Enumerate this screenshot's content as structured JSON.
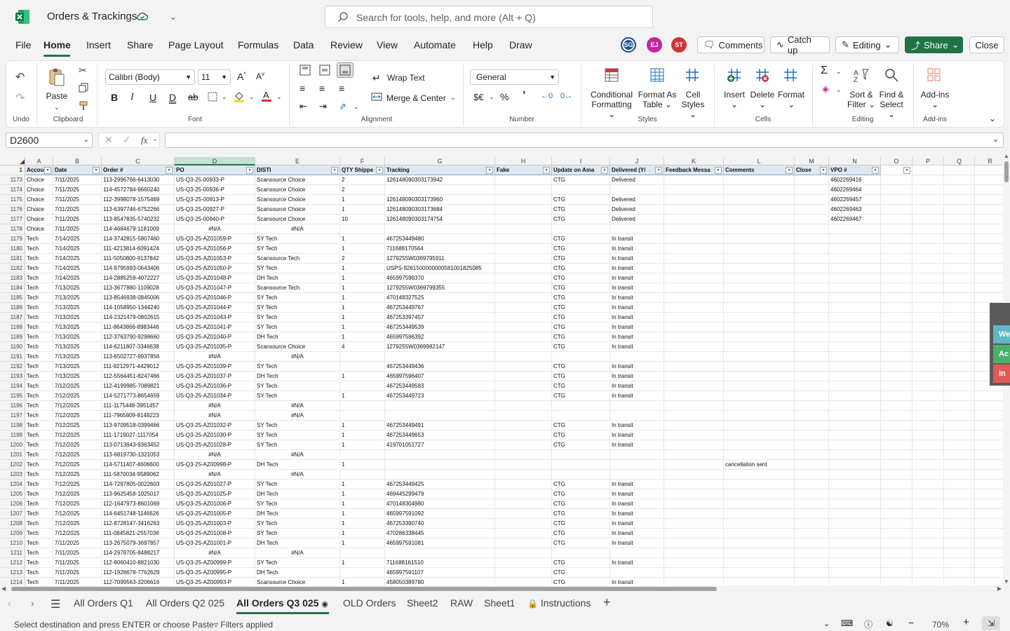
{
  "titlebar": {
    "doc_title": "Orders & Trackings",
    "search_placeholder": "Search for tools, help, and more (Alt + Q)"
  },
  "menu": {
    "tabs": [
      "File",
      "Home",
      "Insert",
      "Share",
      "Page Layout",
      "Formulas",
      "Data",
      "Review",
      "View",
      "Automate",
      "Help",
      "Draw"
    ]
  },
  "collab": {
    "avatars": [
      {
        "initials": "SG",
        "color": "#1f4e8c"
      },
      {
        "initials": "EJ",
        "color": "#c0289d"
      },
      {
        "initials": "ST",
        "color": "#d13438"
      }
    ],
    "comments_label": "Comments",
    "catchup_label": "Catch up",
    "editing_label": "Editing",
    "share_label": "Share",
    "close_label": "Close"
  },
  "ribbon": {
    "undo_label": "Undo",
    "paste_label": "Paste",
    "clipboard_label": "Clipboard",
    "font_name": "Calibri (Body)",
    "font_size": "11",
    "font_label": "Font",
    "wrap_text": "Wrap Text",
    "merge_center": "Merge & Center",
    "alignment_label": "Alignment",
    "number_format": "General",
    "number_label": "Number",
    "conditional_formatting": [
      "Conditional",
      "Formatting"
    ],
    "format_as_table": [
      "Format As",
      "Table"
    ],
    "cell_styles": [
      "Cell",
      "Styles"
    ],
    "styles_label": "Styles",
    "insert_label": "Insert",
    "delete_label": "Delete",
    "format_label": "Format",
    "cells_label": "Cells",
    "sort_filter": [
      "Sort &",
      "Filter"
    ],
    "find_select": [
      "Find &",
      "Select"
    ],
    "editing_label": "Editing",
    "addins_label": "Add-ins",
    "addins_group_label": "Add-ins"
  },
  "formula_bar": {
    "name_box": "D2600",
    "formula": ""
  },
  "grid": {
    "columns": [
      {
        "letter": "A",
        "w": 40
      },
      {
        "letter": "B",
        "w": 69
      },
      {
        "letter": "C",
        "w": 104
      },
      {
        "letter": "D",
        "w": 115
      },
      {
        "letter": "E",
        "w": 121
      },
      {
        "letter": "F",
        "w": 64
      },
      {
        "letter": "G",
        "w": 157
      },
      {
        "letter": "H",
        "w": 81
      },
      {
        "letter": "I",
        "w": 83
      },
      {
        "letter": "J",
        "w": 77
      },
      {
        "letter": "K",
        "w": 85
      },
      {
        "letter": "L",
        "w": 101
      },
      {
        "letter": "M",
        "w": 49
      },
      {
        "letter": "N",
        "w": 74
      },
      {
        "letter": "O",
        "w": 45
      },
      {
        "letter": "P",
        "w": 45
      },
      {
        "letter": "Q",
        "w": 44
      },
      {
        "letter": "R",
        "w": 44
      }
    ],
    "selected_column": "D",
    "headers": [
      "Accou",
      "Date",
      "Order #",
      "PO",
      "DISTI",
      "QTY Shippe",
      "Tracking",
      "Fake",
      "Update on Ama",
      "Delivered (Y/",
      "Feedback Messa",
      "Comments",
      "Close",
      "VPO #",
      "",
      "",
      "",
      ""
    ],
    "rows": [
      [
        "1173",
        "Choice",
        "7/11/2025",
        "113-2996766-6413030",
        "US-Q3-25-00933-P",
        "Scansource Choice",
        "2",
        "126148090303173942",
        "",
        "CTG",
        "Delivered",
        "",
        "",
        "",
        "4602269416"
      ],
      [
        "1174",
        "Choice",
        "7/11/2025",
        "114-4572784-9660240",
        "US-Q3-25-00936-P",
        "Scansource Choice",
        "2",
        "",
        "",
        "",
        "",
        "",
        "",
        "",
        "4602269464"
      ],
      [
        "1175",
        "Choice",
        "7/11/2025",
        "112-3998078-1575469",
        "US-Q3-25-00913-P",
        "Scansource Choice",
        "1",
        "126148090303173960",
        "",
        "CTG",
        "Delivered",
        "",
        "",
        "",
        "4602269457"
      ],
      [
        "1176",
        "Choice",
        "7/11/2025",
        "113-6397746-6752266",
        "US-Q3-25-00927-P",
        "Scansource Choice",
        "1",
        "126148090303173684",
        "",
        "CTG",
        "Delivered",
        "",
        "",
        "",
        "4602269463"
      ],
      [
        "1177",
        "Choice",
        "7/11/2025",
        "113-8547835-5740232",
        "US-Q3-25-00940-P",
        "Scansource Choice",
        "10",
        "126148090303174754",
        "",
        "CTG",
        "Delivered",
        "",
        "",
        "",
        "4602269467"
      ],
      [
        "1178",
        "Choice",
        "7/11/2025",
        "114-4684679-1181009",
        "#N/A",
        "#N/A",
        "",
        "",
        "",
        "",
        "",
        "",
        "",
        "",
        ""
      ],
      [
        "1179",
        "Tech",
        "7/14/2025",
        "114-3742815-5807460",
        "US-Q3-25-AZ01059-P",
        "SY Tech",
        "1",
        "467253449480",
        "",
        "CTG",
        "In transit",
        "",
        "",
        "",
        ""
      ],
      [
        "1180",
        "Tech",
        "7/14/2025",
        "111-4213814-6091424",
        "US-Q3-25-AZ01056-P",
        "SY Tech",
        "1",
        "711688170564",
        "",
        "CTG",
        "In transit",
        "",
        "",
        "",
        ""
      ],
      [
        "1181",
        "Tech",
        "7/14/2025",
        "111-5050800-9137842",
        "US-Q3-25-AZ01053-P",
        "Scansource Tech",
        "2",
        "1279255W0369795911",
        "",
        "CTG",
        "In transit",
        "",
        "",
        "",
        ""
      ],
      [
        "1182",
        "Tech",
        "7/14/2025",
        "114-9795993-0643406",
        "US-Q3-25-AZ01050-P",
        "SY Tech",
        "1",
        "USPS-9261500000000581001825085",
        "",
        "CTG",
        "In transit",
        "",
        "",
        "",
        ""
      ],
      [
        "1183",
        "Tech",
        "7/14/2025",
        "114-2885259-4072227",
        "US-Q3-25-AZ01048-P",
        "DH Tech",
        "1",
        "465997596370",
        "",
        "CTG",
        "In transit",
        "",
        "",
        "",
        ""
      ],
      [
        "1184",
        "Tech",
        "7/13/2025",
        "113-3677880-1109028",
        "US-Q3-25-AZ01047-P",
        "Scansource Tech",
        "1",
        "1279255W0369799355",
        "",
        "CTG",
        "In transit",
        "",
        "",
        "",
        ""
      ],
      [
        "1185",
        "Tech",
        "7/13/2025",
        "113-8546938-0845006",
        "US-Q3-25-AZ01046-P",
        "SY Tech",
        "1",
        "470148327525",
        "",
        "CTG",
        "In transit",
        "",
        "",
        "",
        ""
      ],
      [
        "1186",
        "Tech",
        "7/13/2025",
        "114-1058950-1344240",
        "US-Q3-25-AZ01044-P",
        "SY Tech",
        "1",
        "467253449767",
        "",
        "CTG",
        "In transit",
        "",
        "",
        "",
        ""
      ],
      [
        "1187",
        "Tech",
        "7/13/2025",
        "114-2321479-0802615",
        "US-Q3-25-AZ01043-P",
        "SY Tech",
        "1",
        "467253397457",
        "",
        "CTG",
        "In transit",
        "",
        "",
        "",
        ""
      ],
      [
        "1188",
        "Tech",
        "7/13/2025",
        "111-8643866-8983446",
        "US-Q3-25-AZ01041-P",
        "SY Tech",
        "1",
        "467253449539",
        "",
        "CTG",
        "In transit",
        "",
        "",
        "",
        ""
      ],
      [
        "1189",
        "Tech",
        "7/13/2025",
        "112-3763790-9298660",
        "US-Q3-25-AZ01040-P",
        "DH Tech",
        "1",
        "465997596392",
        "",
        "CTG",
        "In transit",
        "",
        "",
        "",
        ""
      ],
      [
        "1190",
        "Tech",
        "7/13/2025",
        "114-6211807-3346638",
        "US-Q3-25-AZ01035-P",
        "Scansource Choice",
        "4",
        "1279255W0369982147",
        "",
        "CTG",
        "In transit",
        "",
        "",
        "",
        ""
      ],
      [
        "1191",
        "Tech",
        "7/13/2025",
        "113-6502727-9937856",
        "#N/A",
        "#N/A",
        "",
        "",
        "",
        "",
        "",
        "",
        "",
        "",
        ""
      ],
      [
        "1192",
        "Tech",
        "7/13/2025",
        "111-8212971-4429012",
        "US-Q3-25-AZ01039-P",
        "SY Tech",
        "",
        "467253449436",
        "",
        "CTG",
        "In transit",
        "",
        "",
        "",
        ""
      ],
      [
        "1193",
        "Tech",
        "7/13/2025",
        "112-5564451-8247466",
        "US-Q3-25-AZ01037-P",
        "DH Tech",
        "1",
        "465997596407",
        "",
        "CTG",
        "In transit",
        "",
        "",
        "",
        ""
      ],
      [
        "1194",
        "Tech",
        "7/12/2025",
        "112-4199985-7089821",
        "US-Q3-25-AZ01036-P",
        "SY Tech",
        "",
        "467253449583",
        "",
        "CTG",
        "In transit",
        "",
        "",
        "",
        ""
      ],
      [
        "1195",
        "Tech",
        "7/12/2025",
        "114-5271773-8654659",
        "US-Q3-25-AZ01034-P",
        "SY Tech",
        "1",
        "467253449723",
        "",
        "CTG",
        "In transit",
        "",
        "",
        "",
        ""
      ],
      [
        "1196",
        "Tech",
        "7/12/2025",
        "111-1175448-3951457",
        "#N/A",
        "#N/A",
        "",
        "",
        "",
        "",
        "",
        "",
        "",
        "",
        ""
      ],
      [
        "1197",
        "Tech",
        "7/12/2025",
        "111-7965809-8148223",
        "#N/A",
        "#N/A",
        "",
        "",
        "",
        "",
        "",
        "",
        "",
        "",
        ""
      ],
      [
        "1198",
        "Tech",
        "7/12/2025",
        "113-9709518-0399466",
        "US-Q3-25-AZ01032-P",
        "SY Tech",
        "1",
        "467253449491",
        "",
        "CTG",
        "In transit",
        "",
        "",
        "",
        ""
      ],
      [
        "1199",
        "Tech",
        "7/12/2025",
        "111-1719027-1117054",
        "US-Q3-25-AZ01030-P",
        "SY Tech",
        "1",
        "467253449653",
        "",
        "CTG",
        "In transit",
        "",
        "",
        "",
        ""
      ],
      [
        "1200",
        "Tech",
        "7/12/2025",
        "113-0713943-9363452",
        "US-Q3-25-AZ01028-P",
        "SY Tech",
        "1",
        "419701051727",
        "",
        "CTG",
        "In transit",
        "",
        "",
        "",
        ""
      ],
      [
        "1201",
        "Tech",
        "7/12/2025",
        "113-6819730-1321053",
        "#N/A",
        "#N/A",
        "",
        "",
        "",
        "",
        "",
        "",
        "",
        "",
        ""
      ],
      [
        "1202",
        "Tech",
        "7/12/2025",
        "114-5711407-4606600",
        "US-Q3-25-AZ00998-P",
        "DH Tech",
        "1",
        "",
        "",
        "",
        "",
        "",
        "cancellation sent",
        "",
        ""
      ],
      [
        "1203",
        "Tech",
        "7/12/2025",
        "111-5870034-9589062",
        "#N/A",
        "#N/A",
        "",
        "",
        "",
        "",
        "",
        "",
        "",
        "",
        ""
      ],
      [
        "1204",
        "Tech",
        "7/12/2025",
        "114-7297805-0022603",
        "US-Q3-25-AZ01027-P",
        "SY Tech",
        "1",
        "467253449425",
        "",
        "CTG",
        "In transit",
        "",
        "",
        "",
        ""
      ],
      [
        "1205",
        "Tech",
        "7/12/2025",
        "113-9625458-1025017",
        "US-Q3-25-AZ01025-P",
        "DH Tech",
        "1",
        "469445299479",
        "",
        "CTG",
        "In transit",
        "",
        "",
        "",
        ""
      ],
      [
        "1206",
        "Tech",
        "7/12/2025",
        "112-1647973-8601069",
        "US-Q3-25-AZ01006-P",
        "SY Tech",
        "1",
        "470148304980",
        "",
        "CTG",
        "In transit",
        "",
        "",
        "",
        ""
      ],
      [
        "1207",
        "Tech",
        "7/12/2025",
        "114-6451748-1146626",
        "US-Q3-25-AZ01005-P",
        "DH Tech",
        "1",
        "465997591092",
        "",
        "CTG",
        "In transit",
        "",
        "",
        "",
        ""
      ],
      [
        "1208",
        "Tech",
        "7/12/2025",
        "112-8728147-3416263",
        "US-Q3-25-AZ01003-P",
        "SY Tech",
        "1",
        "467253390740",
        "",
        "CTG",
        "In transit",
        "",
        "",
        "",
        ""
      ],
      [
        "1209",
        "Tech",
        "7/12/2025",
        "111-0845821-2557036",
        "US-Q3-25-AZ01008-P",
        "SY Tech",
        "1",
        "470286338445",
        "",
        "CTG",
        "In transit",
        "",
        "",
        "",
        ""
      ],
      [
        "1210",
        "Tech",
        "7/11/2025",
        "113-2675079-3697857",
        "US-Q3-25-AZ01001-P",
        "DH Tech",
        "1",
        "465997591081",
        "",
        "CTG",
        "In transit",
        "",
        "",
        "",
        ""
      ],
      [
        "1211",
        "Tech",
        "7/11/2025",
        "114-2978705-8488217",
        "#N/A",
        "#N/A",
        "",
        "",
        "",
        "",
        "",
        "",
        "",
        "",
        ""
      ],
      [
        "1212",
        "Tech",
        "7/11/2025",
        "112-8060410-8821030",
        "US-Q3-25-AZ00999-P",
        "SY Tech",
        "1",
        "711688161510",
        "",
        "CTG",
        "In transit",
        "",
        "",
        "",
        ""
      ],
      [
        "1213",
        "Tech",
        "7/11/2025",
        "112-1928678-7762629",
        "US-Q3-25-AZ00995-P",
        "DH Tech",
        "",
        "465997591107",
        "",
        "CTG",
        "",
        "",
        "",
        "",
        ""
      ],
      [
        "1214",
        "Tech",
        "7/11/2025",
        "112-7099563-3206616",
        "US-Q3-25-AZ00993-P",
        "Scansource Choice",
        "1",
        "458050389780",
        "",
        "CTG",
        "In transit",
        "",
        "",
        "",
        ""
      ]
    ]
  },
  "side_panel": {
    "tags": [
      {
        "text": "We",
        "color": "#5fb8c8"
      },
      {
        "text": "Ac",
        "color": "#4caf6a"
      },
      {
        "text": "In",
        "color": "#e05a55"
      }
    ]
  },
  "sheets": {
    "tabs": [
      "All Orders Q1",
      "All Orders Q2 025",
      "All Orders Q3 025",
      "OLD Orders",
      "Sheet2",
      "RAW",
      "Sheet1",
      "Instructions"
    ],
    "active_index": 2
  },
  "status": {
    "message": "Select destination and press ENTER or choose Paste",
    "filters": "Filters applied",
    "zoom": "70%"
  }
}
